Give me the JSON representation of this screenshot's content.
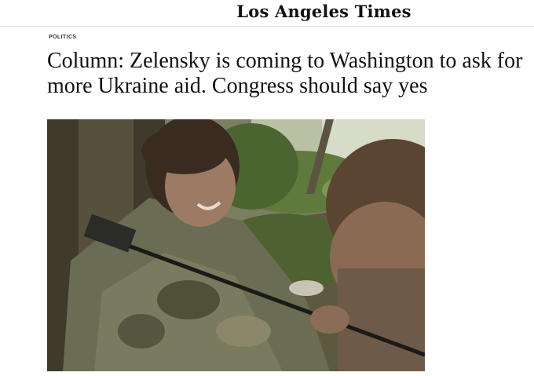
{
  "masthead": {
    "logo_text": "Los Angeles Times"
  },
  "article": {
    "section": "POLITICS",
    "headline": "Column: Zelensky is coming to Washington to ask for more Ukraine aid. Congress should say yes",
    "image": {
      "description_icon": "photo-image",
      "colors": {
        "sky": "#d7dcc8",
        "foliage": "#566a36",
        "uniform": "#6e7058",
        "skin": "#9c7a63",
        "hair": "#3a2b20"
      }
    }
  }
}
